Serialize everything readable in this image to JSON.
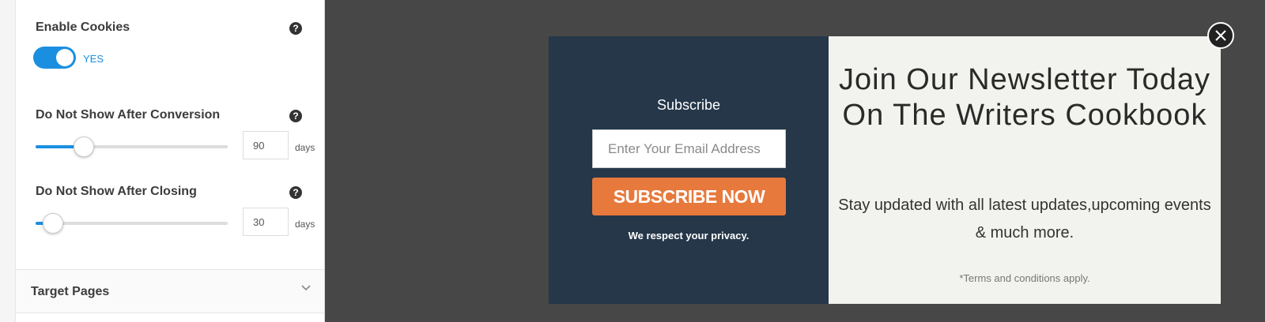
{
  "settings": {
    "enable_cookies": {
      "label": "Enable Cookies",
      "help": "?",
      "state_text": "YES",
      "on": true
    },
    "after_conversion": {
      "label": "Do Not Show After Conversion",
      "help": "?",
      "value": "90",
      "unit": "days",
      "slider_fraction": 0.25
    },
    "after_closing": {
      "label": "Do Not Show After Closing",
      "help": "?",
      "value": "30",
      "unit": "days",
      "slider_fraction": 0.09
    },
    "target_pages": {
      "label": "Target Pages",
      "icon": "chevron-down-icon"
    }
  },
  "popup": {
    "subscribe_title": "Subscribe",
    "email_placeholder": "Enter Your Email Address",
    "button_label": "SUBSCRIBE NOW",
    "privacy_text": "We respect your privacy.",
    "headline": "Join Our Newsletter Today On The Writers Cookbook",
    "body": "Stay updated with all latest updates,upcoming events & much more.",
    "terms": "*Terms and conditions apply.",
    "close_icon": "close-icon"
  },
  "colors": {
    "accent": "#1a8fe0",
    "popup_dark": "#253749",
    "popup_light": "#f2f2ee",
    "button": "#e7793d",
    "overlay": "#474747"
  }
}
